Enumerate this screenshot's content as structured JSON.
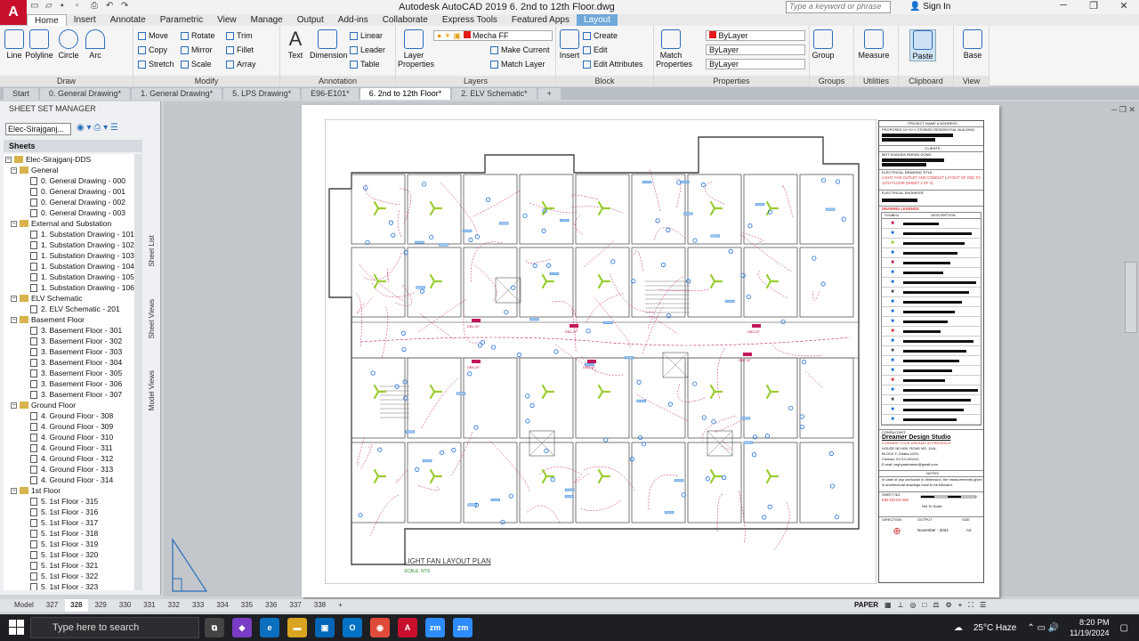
{
  "app": {
    "logo_letter": "A",
    "title": "Autodesk AutoCAD 2019    6. 2nd to 12th Floor.dwg",
    "search_placeholder": "Type a keyword or phrase",
    "signin": "Sign In"
  },
  "menu": [
    "Home",
    "Insert",
    "Annotate",
    "Parametric",
    "View",
    "Manage",
    "Output",
    "Add-ins",
    "Collaborate",
    "Express Tools",
    "Featured Apps",
    "Layout"
  ],
  "ribbon": {
    "draw": {
      "title": "Draw",
      "tools": [
        "Line",
        "Polyline",
        "Circle",
        "Arc"
      ]
    },
    "modify": {
      "title": "Modify",
      "tools": [
        "Move",
        "Rotate",
        "Trim",
        "Copy",
        "Mirror",
        "Fillet",
        "Stretch",
        "Scale",
        "Array"
      ]
    },
    "annotation": {
      "title": "Annotation",
      "text": "Text",
      "dimension": "Dimension",
      "tools": [
        "Linear",
        "Leader",
        "Table"
      ]
    },
    "layers": {
      "title": "Layers",
      "layer_props": "Layer Properties",
      "current_layer": "Mecha FF",
      "make_current": "Make Current",
      "match_layer": "Match Layer"
    },
    "block": {
      "title": "Block",
      "insert": "Insert",
      "tools": [
        "Create",
        "Edit",
        "Edit Attributes"
      ]
    },
    "properties": {
      "title": "Properties",
      "match": "Match Properties",
      "color": "ByLayer",
      "linetype": "ByLayer",
      "lineweight": "ByLayer"
    },
    "groups": {
      "title": "Groups",
      "group": "Group"
    },
    "utilities": {
      "title": "Utilities",
      "measure": "Measure"
    },
    "clipboard": {
      "title": "Clipboard",
      "paste": "Paste"
    },
    "view": {
      "title": "View",
      "base": "Base"
    }
  },
  "file_tabs": [
    "Start",
    "0. General Drawing*",
    "1. General Drawing*",
    "5. LPS Drawing*",
    "E96-E101*",
    "6. 2nd to 12th Floor*",
    "2. ELV Schematic*"
  ],
  "ssm": {
    "title": "SHEET SET MANAGER",
    "combo": "Elec-Sirajganj...",
    "sheets_label": "Sheets",
    "side_tabs": [
      "Sheet List",
      "Sheet Views",
      "Model Views"
    ],
    "tree": [
      {
        "type": "root",
        "label": "Elec-Sirajganj-DDS"
      },
      {
        "type": "group",
        "label": "General"
      },
      {
        "type": "sheet",
        "label": "0. General Drawing - 000"
      },
      {
        "type": "sheet",
        "label": "0. General Drawing - 001"
      },
      {
        "type": "sheet",
        "label": "0. General Drawing - 002"
      },
      {
        "type": "sheet",
        "label": "0. General Drawing - 003"
      },
      {
        "type": "group",
        "label": "External and Substation"
      },
      {
        "type": "sheet",
        "label": "1. Substation Drawing - 101"
      },
      {
        "type": "sheet",
        "label": "1. Substation Drawing - 102"
      },
      {
        "type": "sheet",
        "label": "1. Substation Drawing - 103"
      },
      {
        "type": "sheet",
        "label": "1. Substation Drawing - 104"
      },
      {
        "type": "sheet",
        "label": "1. Substation Drawing - 105"
      },
      {
        "type": "sheet",
        "label": "1. Substation Drawing - 106"
      },
      {
        "type": "group",
        "label": "ELV Schematic"
      },
      {
        "type": "sheet",
        "label": "2. ELV Schematic - 201"
      },
      {
        "type": "group",
        "label": "Basement Floor"
      },
      {
        "type": "sheet",
        "label": "3. Basement Floor - 301"
      },
      {
        "type": "sheet",
        "label": "3. Basement Floor - 302"
      },
      {
        "type": "sheet",
        "label": "3. Basement Floor - 303"
      },
      {
        "type": "sheet",
        "label": "3. Basement Floor - 304"
      },
      {
        "type": "sheet",
        "label": "3. Basement Floor - 305"
      },
      {
        "type": "sheet",
        "label": "3. Basement Floor - 306"
      },
      {
        "type": "sheet",
        "label": "3. Basement Floor - 307"
      },
      {
        "type": "group",
        "label": "Ground Floor"
      },
      {
        "type": "sheet",
        "label": "4. Ground Floor - 308"
      },
      {
        "type": "sheet",
        "label": "4. Ground Floor - 309"
      },
      {
        "type": "sheet",
        "label": "4. Ground Floor - 310"
      },
      {
        "type": "sheet",
        "label": "4. Ground Floor - 311"
      },
      {
        "type": "sheet",
        "label": "4. Ground Floor - 312"
      },
      {
        "type": "sheet",
        "label": "4. Ground Floor - 313"
      },
      {
        "type": "sheet",
        "label": "4. Ground Floor - 314"
      },
      {
        "type": "group",
        "label": "1st Floor"
      },
      {
        "type": "sheet",
        "label": "5. 1st Floor - 315"
      },
      {
        "type": "sheet",
        "label": "5. 1st Floor - 316"
      },
      {
        "type": "sheet",
        "label": "5. 1st Floor - 317"
      },
      {
        "type": "sheet",
        "label": "5. 1st Floor - 318"
      },
      {
        "type": "sheet",
        "label": "5. 1st Floor - 319"
      },
      {
        "type": "sheet",
        "label": "5. 1st Floor - 320"
      },
      {
        "type": "sheet",
        "label": "5. 1st Floor - 321"
      },
      {
        "type": "sheet",
        "label": "5. 1st Floor - 322"
      },
      {
        "type": "sheet",
        "label": "5. 1st Floor - 323"
      }
    ]
  },
  "drawing": {
    "title": "LIGHT FAN LAYOUT PLAN",
    "scale": "SCALE: NTS",
    "db_labels": [
      "DB1-2F",
      "DB2-2F",
      "DB3-2F",
      "DB6-2F",
      "DB5-2F",
      "DB7-2F"
    ]
  },
  "title_block": {
    "project_head": "- PROJECT NAME & ADDRESS -",
    "project_name": "PROPOSED 10+G+1 STORIED RESIDENTIAL BUILDING",
    "clients_head": "- CLIENTS -",
    "client_name": "MST KHADIZA PARVIN GONG",
    "drawing_title_head": "ELECTRICAL DRAWING TITLE",
    "drawing_title": "LIGHT, FAN OUTLET AND CONDUIT LAYOUT OF 2ND TO 12TH FLOOR (SHEET 2 OF 3)",
    "engineer_head": "ELECTRICAL ENGINEER",
    "legends_head": "DRAWING LEGENDS",
    "symbol": "SYMBOL",
    "description": "DESCRIPTION",
    "consultant_head": "CONSULTANT:",
    "studio": "Dreamer Design Studio",
    "studio_tag": "FORMING YOUR DREAMS IN PRESENCE",
    "address": [
      "HOUSE NO.600, ROAD NO. 10/A,",
      "BLOCK F, Dhaka-1229,",
      "Contact: 01712-601011,",
      "E-mail: arghyadreamer@gmail.com"
    ],
    "notes_head": "NOTES",
    "notes": "In case of any confusion in dimension, the measurements given in architectural drawings have to be followed.",
    "sheet_no_head": "SHEET NO.",
    "sheet_no": "E96-DD-E6-406",
    "bar_scale": "Not To Scale",
    "direction": "DIRECTION",
    "output": "OUTPUT",
    "size": "SIZE",
    "date": "November - 2024",
    "paper_size": "A3"
  },
  "layout_tabs": [
    "Model",
    "327",
    "328",
    "329",
    "330",
    "331",
    "332",
    "333",
    "334",
    "335",
    "336",
    "337",
    "338"
  ],
  "status": {
    "paper": "PAPER"
  },
  "taskbar": {
    "search": "Type here to search",
    "weather": "25°C  Haze",
    "time": "8:20 PM",
    "date": "11/19/2024"
  },
  "colors": {
    "autocad_red": "#c8102e",
    "fan_green": "#9acd32",
    "circuit_magenta": "#c2185b",
    "fixture_blue": "#1e6fd9"
  }
}
